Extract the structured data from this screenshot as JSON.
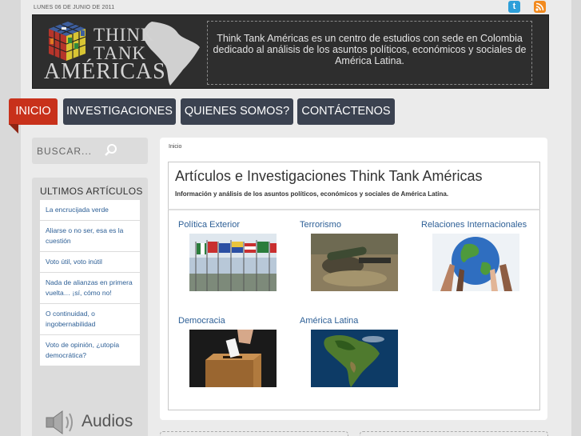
{
  "header": {
    "date": "LUNES 06 DE JUNIO DE 2011",
    "social": [
      {
        "name": "twitter",
        "icon": "twitter-icon",
        "glyph": "t",
        "color": "#2d9fd9"
      },
      {
        "name": "rss",
        "icon": "rss-icon",
        "color": "#f28a1e"
      }
    ]
  },
  "banner": {
    "logo_lines": [
      "THINK",
      "TANK",
      "AMÉRICAS"
    ],
    "description": "Think Tank Américas es un centro de estudios con sede en Colombia dedicado al análisis de los asuntos políticos, económicos y sociales de América Latina."
  },
  "nav": [
    {
      "label": "INICIO",
      "active": true
    },
    {
      "label": "INVESTIGACIONES",
      "active": false
    },
    {
      "label": "QUIENES SOMOS?",
      "active": false
    },
    {
      "label": "CONTÁCTENOS",
      "active": false
    }
  ],
  "sidebar": {
    "search_placeholder": "BUSCAR...",
    "latest_title": "ULTIMOS ARTÍCULOS",
    "latest": [
      "La encrucijada verde",
      "Aliarse o no ser, esa es la cuestión",
      "Voto útil, voto inútil",
      "Nada de alianzas en primera vuelta… ¡sí, cómo no!",
      "O continuidad, o ingobernabilidad",
      "Voto de opinión, ¿utopía democrática?"
    ],
    "audios_label": "Audios"
  },
  "main": {
    "breadcrumb": "Inicio",
    "title": "Artículos e Investigaciones Think Tank Américas",
    "subtitle": "Información y análisis de los asuntos políticos, económicos y sociales de América Latina.",
    "categories": [
      {
        "title": "Política Exterior"
      },
      {
        "title": "Terrorismo"
      },
      {
        "title": "Relaciones Internacionales"
      },
      {
        "title": "Democracia"
      },
      {
        "title": "América Latina"
      }
    ]
  },
  "colors": {
    "nav_bg": "#3b4250",
    "nav_active": "#c8311b",
    "link": "#2d5f96",
    "banner_bg": "#2e2e2e"
  }
}
